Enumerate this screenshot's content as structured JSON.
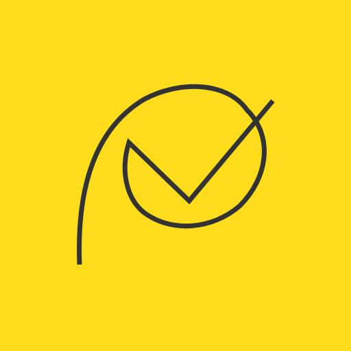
{
  "colors": {
    "background": "#FDDC1C",
    "stroke": "#333333"
  },
  "icon": {
    "name": "p-checkmark-logo-icon"
  }
}
